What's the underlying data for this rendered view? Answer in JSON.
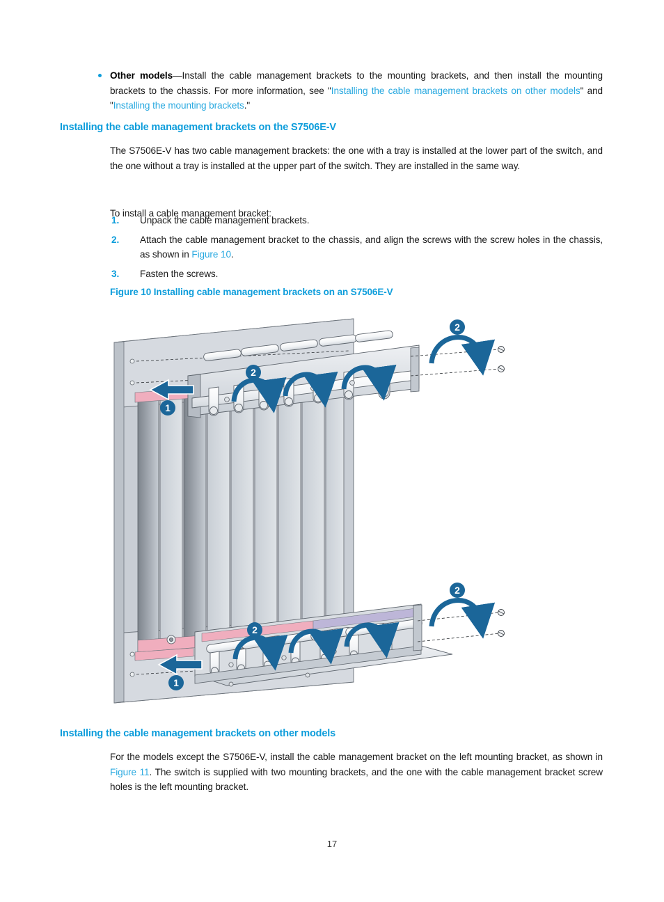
{
  "page": {
    "number": "17"
  },
  "bullet_item": {
    "lead": "Other models",
    "text_1": "—Install the cable management brackets to the mounting brackets, and then install the mounting brackets to the chassis. For more information, see \"",
    "link_1": "Installing the cable management brackets on other models",
    "text_2": "\" and \"",
    "link_2": "Installing the mounting brackets",
    "text_3": ".\""
  },
  "section_s7506": {
    "heading": "Installing the cable management brackets on the S7506E-V",
    "intro": "The S7506E-V has two cable management brackets: the one with a tray is installed at the lower part of the switch, and the one without a tray is installed at the upper part of the switch. They are installed in the same way.",
    "lead_in": "To install a cable management bracket:",
    "steps": [
      {
        "num": "1.",
        "text": "Unpack the cable management brackets."
      },
      {
        "num": "2.",
        "pre": "Attach the cable management bracket to the chassis, and align the screws with the screw holes in the chassis, as shown in ",
        "link": "Figure 10",
        "post": "."
      },
      {
        "num": "3.",
        "text": "Fasten the screws."
      }
    ]
  },
  "figure": {
    "caption": "Figure 10 Installing cable management brackets on an S7506E-V",
    "callouts": [
      "1",
      "2",
      "2",
      "1",
      "2",
      "2"
    ],
    "description": "Exploded isometric view of an S7506E-V chassis with upper and lower cable management brackets being attached; step 1 arrows push brackets toward the chassis, step 2 curved arrows indicate fastening screws."
  },
  "section_other": {
    "heading": "Installing the cable management brackets on other models",
    "pre": "For the models except the S7506E-V, install the cable management bracket on the left mounting bracket, as shown in ",
    "link": "Figure 11",
    "post": ". The switch is supplied with two mounting brackets, and the one with the cable management bracket screw holes is the left mounting bracket."
  },
  "colors": {
    "heading_blue": "#0d9ddb",
    "link_blue": "#29a9e0",
    "arrow_blue": "#1b6699",
    "body_text": "#1a1a1a",
    "metal_light": "#d4d8dd",
    "metal_mid": "#bfc5cc",
    "metal_dark": "#9aa1a9",
    "pink_strip": "#f0aebe",
    "purple_strip": "#bdb6d8"
  }
}
